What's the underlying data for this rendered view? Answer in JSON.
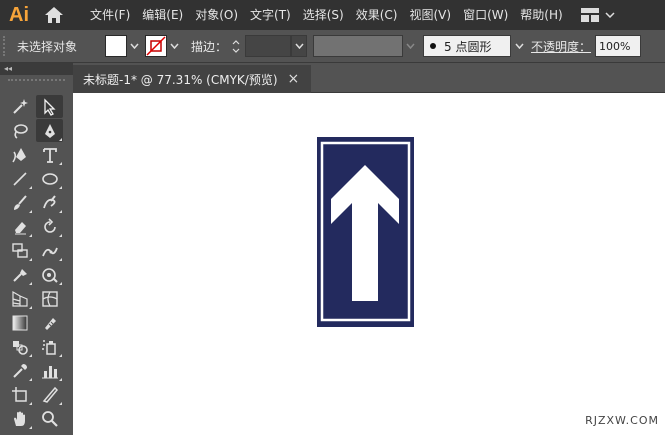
{
  "app": {
    "logo": "Ai"
  },
  "menu": [
    "文件(F)",
    "编辑(E)",
    "对象(O)",
    "文字(T)",
    "选择(S)",
    "效果(C)",
    "视图(V)",
    "窗口(W)",
    "帮助(H)"
  ],
  "control": {
    "selection_status": "未选择对象",
    "stroke_label": "描边：",
    "brush_label": "5 点圆形",
    "opacity_label": "不透明度：",
    "opacity_value": "100%"
  },
  "panel": {
    "collapse_label": "◂◂"
  },
  "document": {
    "tab_title": "未标题-1* @ 77.31% (CMYK/预览)",
    "close_label": "×"
  },
  "artwork": {
    "sign_color": "#232a5e",
    "arrow_color": "#ffffff"
  },
  "watermark": "RJZXW.COM",
  "tools": [
    [
      "magic-wand-icon",
      "direct-selection-icon"
    ],
    [
      "lasso-icon",
      "pen-icon"
    ],
    [
      "curvature-icon",
      "type-icon"
    ],
    [
      "line-segment-icon",
      "ellipse-icon"
    ],
    [
      "paintbrush-icon",
      "shaper-icon"
    ],
    [
      "eraser-icon",
      "rotate-icon"
    ],
    [
      "width-icon",
      "puppet-warp-icon"
    ],
    [
      "shape-builder-icon",
      "live-paint-icon"
    ],
    [
      "perspective-grid-icon",
      "mesh-icon"
    ],
    [
      "gradient-icon",
      "eyedropper-bar-icon"
    ],
    [
      "blend-icon",
      "symbol-sprayer-icon"
    ],
    [
      "eyedropper-icon",
      "column-graph-icon"
    ],
    [
      "artboard-icon",
      "slice-icon"
    ],
    [
      "hand-icon",
      "zoom-icon"
    ]
  ]
}
